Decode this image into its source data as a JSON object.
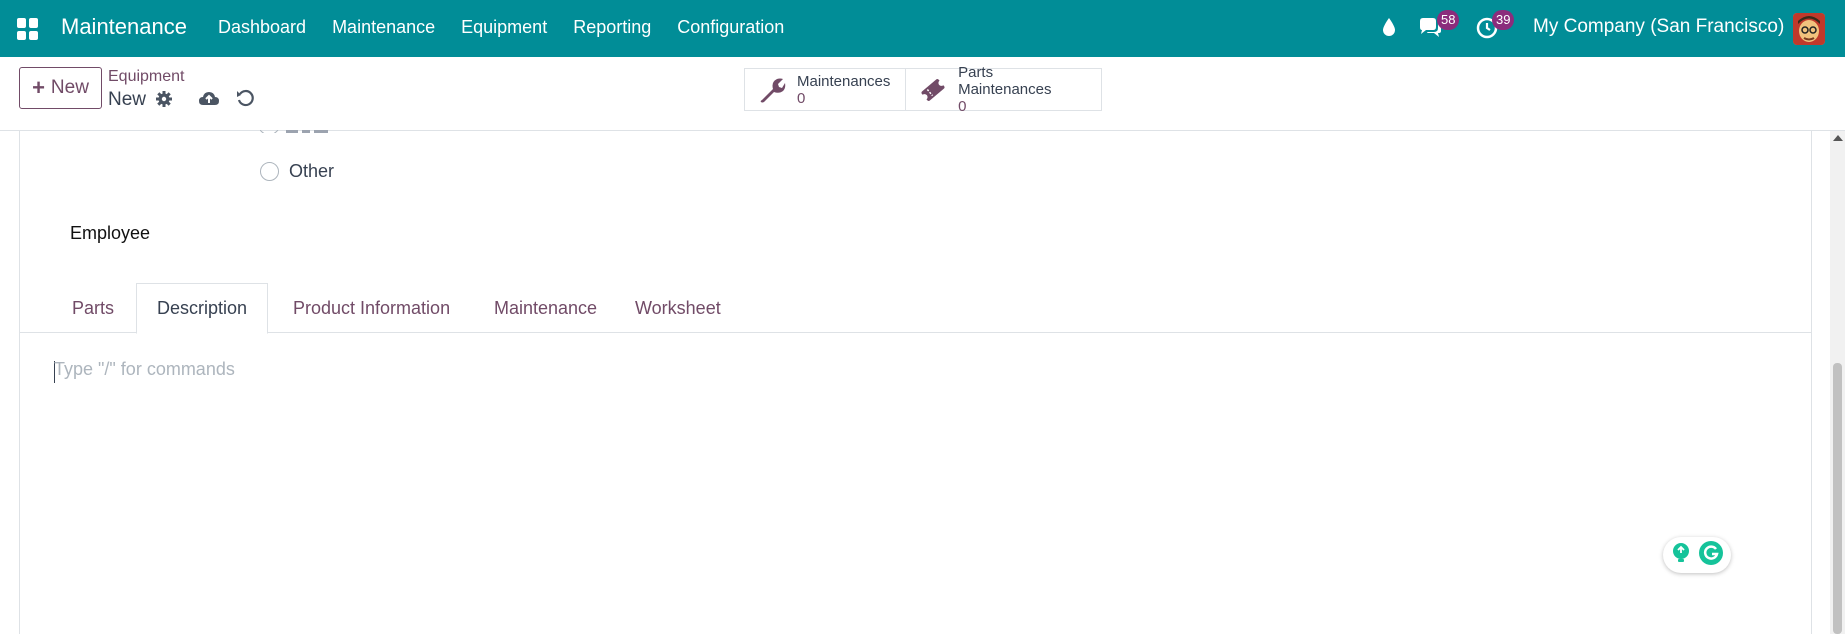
{
  "navbar": {
    "brand": "Maintenance",
    "menu": [
      "Dashboard",
      "Maintenance",
      "Equipment",
      "Reporting",
      "Configuration"
    ],
    "messages_count": "58",
    "activities_count": "39",
    "company": "My Company (San Francisco)",
    "icons": [
      "apps-grid-icon",
      "water-drop-icon",
      "chat-icon",
      "clock-icon",
      "avatar"
    ]
  },
  "control_panel": {
    "new_label": "New",
    "breadcrumb_parent": "Equipment",
    "breadcrumb_current": "New",
    "smart_buttons": [
      {
        "label": "Maintenances",
        "value": "0",
        "icon": "wrench-icon"
      },
      {
        "label": "Parts Maintenances",
        "value": "0",
        "icon": "ticket-icon"
      }
    ]
  },
  "form": {
    "radio_option": "Other",
    "employee_label": "Employee",
    "tabs": [
      "Parts",
      "Description",
      "Product Information",
      "Maintenance",
      "Worksheet"
    ],
    "active_tab": "Description",
    "editor_placeholder": "Type \"/\" for commands"
  },
  "colors": {
    "navbar": "#018d97",
    "primary": "#714b67",
    "badge": "#8b2c7c"
  }
}
